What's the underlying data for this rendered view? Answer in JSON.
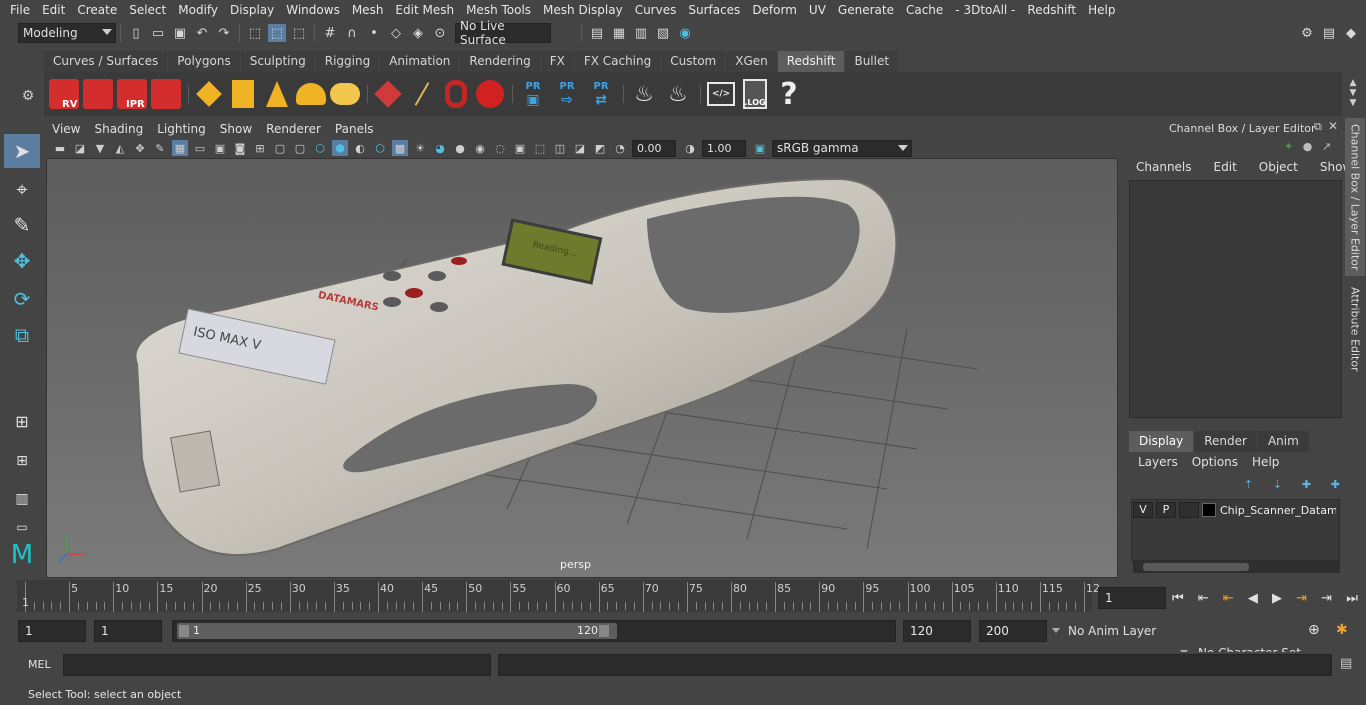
{
  "menubar": [
    "File",
    "Edit",
    "Create",
    "Select",
    "Modify",
    "Display",
    "Windows",
    "Mesh",
    "Edit Mesh",
    "Mesh Tools",
    "Mesh Display",
    "Curves",
    "Surfaces",
    "Deform",
    "UV",
    "Generate",
    "Cache",
    "- 3DtoAll -",
    "Redshift",
    "Help"
  ],
  "statusline": {
    "mode": "Modeling",
    "live_surface": "No Live Surface"
  },
  "shelf": {
    "tabs": [
      "Curves / Surfaces",
      "Polygons",
      "Sculpting",
      "Rigging",
      "Animation",
      "Rendering",
      "FX",
      "FX Caching",
      "Custom",
      "XGen",
      "Redshift",
      "Bullet"
    ],
    "active_tab": "Redshift",
    "cube_labels": [
      "RV",
      "",
      "IPR",
      ""
    ],
    "pr_labels": [
      "PR",
      "PR",
      "PR"
    ],
    "log_label": ".LOG",
    "help_label": "?"
  },
  "viewport": {
    "menu": [
      "View",
      "Shading",
      "Lighting",
      "Show",
      "Renderer",
      "Panels"
    ],
    "exposure": "0.00",
    "gamma": "1.00",
    "color_space": "sRGB gamma",
    "camera_label": "persp",
    "model_brand": "DATAMARS",
    "model_screen_text": "Reading...",
    "model_sticker_text": "ISO MAX V"
  },
  "channel_box": {
    "title": "Channel Box / Layer Editor",
    "menu": [
      "Channels",
      "Edit",
      "Object",
      "Show"
    ],
    "layer_tabs": [
      "Display",
      "Render",
      "Anim"
    ],
    "active_layer_tab": "Display",
    "layer_menu": [
      "Layers",
      "Options",
      "Help"
    ],
    "layer": {
      "v": "V",
      "p": "P",
      "name": "Chip_Scanner_Datama"
    },
    "side_tabs": [
      "Channel Box / Layer Editor",
      "Attribute Editor"
    ]
  },
  "timeline": {
    "ticks": [
      "5",
      "10",
      "15",
      "20",
      "25",
      "30",
      "35",
      "40",
      "45",
      "50",
      "55",
      "60",
      "65",
      "70",
      "75",
      "80",
      "85",
      "90",
      "95",
      "100",
      "105",
      "110",
      "115",
      "12"
    ],
    "start_marker": "1",
    "current_frame": "1"
  },
  "range": {
    "start": "1",
    "playback_start": "1",
    "slider_start": "1",
    "slider_end": "120",
    "playback_end": "120",
    "end": "200",
    "anim_layer": "No Anim Layer",
    "character_set": "No Character Set"
  },
  "command": {
    "label": "MEL"
  },
  "help_line": "Select Tool: select an object"
}
